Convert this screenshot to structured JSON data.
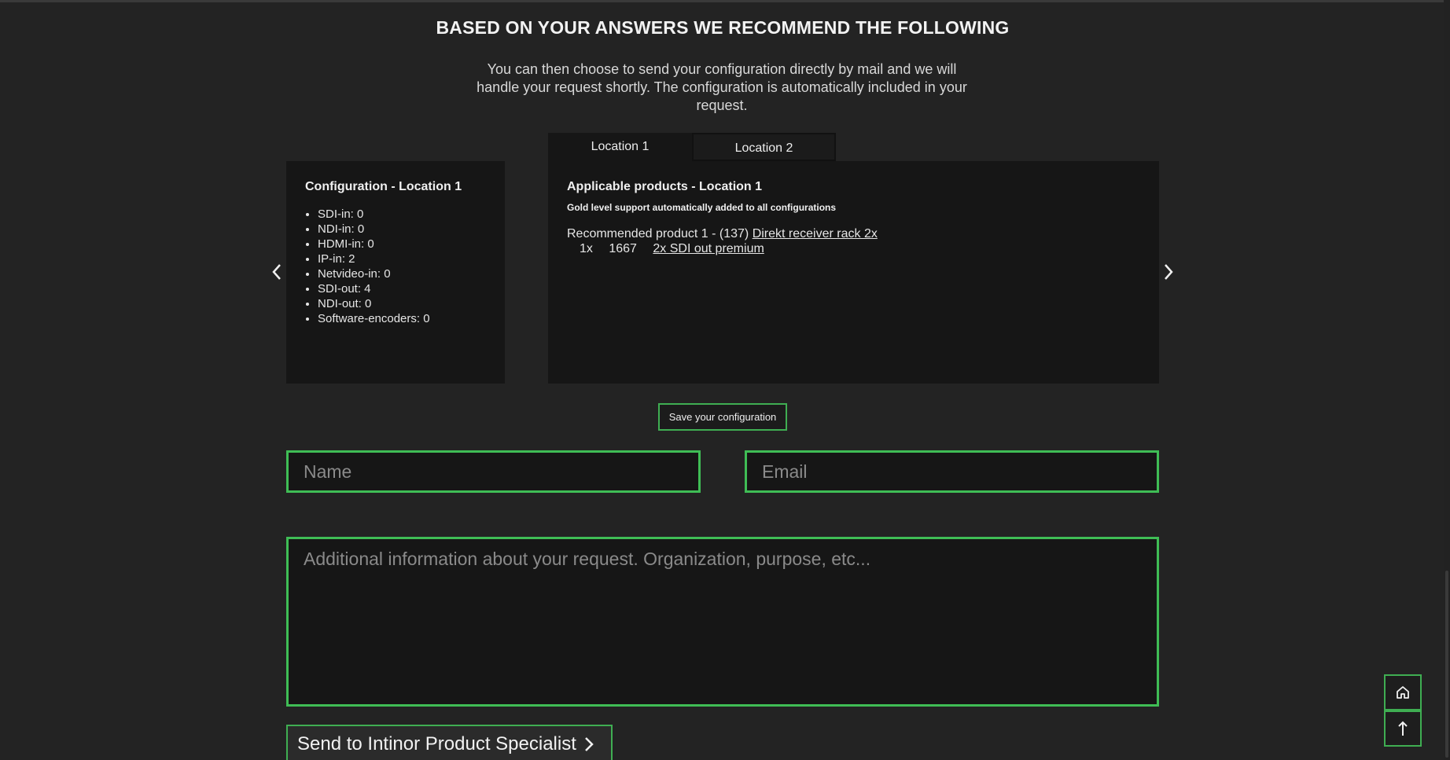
{
  "heading": "BASED ON YOUR ANSWERS WE RECOMMEND THE FOLLOWING",
  "intro": "You can then choose to send your configuration directly by mail and we will handle your request shortly. The configuration is automatically included in your request.",
  "tabs": [
    {
      "label": "Location 1",
      "active": true
    },
    {
      "label": "Location 2",
      "active": false
    }
  ],
  "configuration": {
    "title": "Configuration - Location 1",
    "items": [
      "SDI-in: 0",
      "NDI-in: 0",
      "HDMI-in: 0",
      "IP-in: 2",
      "Netvideo-in: 0",
      "SDI-out: 4",
      "NDI-out: 0",
      "Software-encoders: 0"
    ]
  },
  "products": {
    "title": "Applicable products - Location 1",
    "note": "Gold level support automatically added to all configurations",
    "recommended_prefix": "Recommended product 1 - (137)",
    "recommended_link": "Direkt receiver rack 2x",
    "addon_qty": "1x",
    "addon_code": "1667",
    "addon_link": "2x SDI out premium"
  },
  "save_button": "Save your configuration",
  "form": {
    "name_placeholder": "Name",
    "email_placeholder": "Email",
    "info_placeholder": "Additional information about your request. Organization, purpose, etc..."
  },
  "send_button": "Send to Intinor Product Specialist",
  "icons": {
    "prev": "chevron-left-icon",
    "next": "chevron-right-icon",
    "send_chevron": "chevron-right-icon",
    "home": "home-icon",
    "up": "arrow-up-icon"
  },
  "colors": {
    "background": "#232323",
    "panel": "#161616",
    "accent_green": "#3fbd55"
  }
}
